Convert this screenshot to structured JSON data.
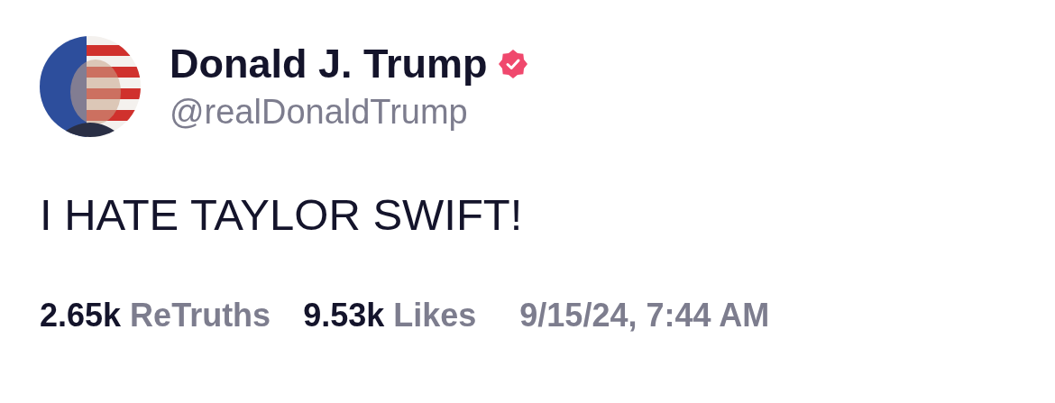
{
  "author": {
    "name": "Donald J. Trump",
    "verified": true,
    "handle": "@realDonaldTrump"
  },
  "post": {
    "text": "I HATE TAYLOR SWIFT!"
  },
  "stats": [
    {
      "count": "2.65k",
      "label": "ReTruths"
    },
    {
      "count": "9.53k",
      "label": "Likes"
    }
  ],
  "timestamp": "9/15/24, 7:44 AM"
}
